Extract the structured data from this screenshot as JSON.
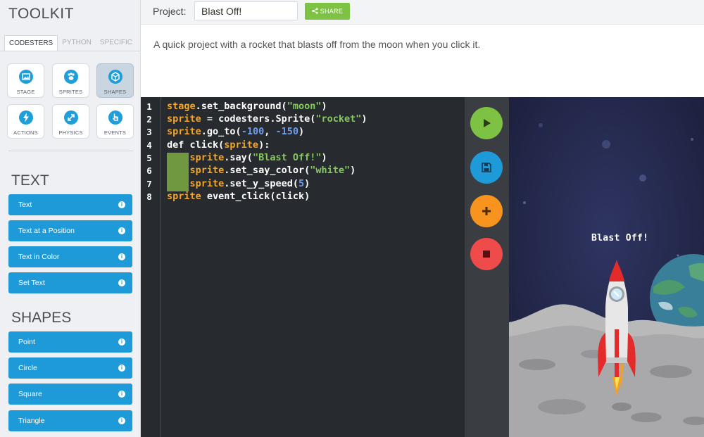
{
  "sidebar": {
    "title": "TOOLKIT",
    "tabs": [
      "CODESTERS",
      "PYTHON",
      "SPECIFIC"
    ],
    "tools": [
      {
        "label": "STAGE",
        "icon": "image-icon"
      },
      {
        "label": "SPRITES",
        "icon": "paw-icon"
      },
      {
        "label": "SHAPES",
        "icon": "cube-icon"
      },
      {
        "label": "ACTIONS",
        "icon": "lightning-icon"
      },
      {
        "label": "PHYSICS",
        "icon": "arrows-icon"
      },
      {
        "label": "EVENTS",
        "icon": "pointer-hand-icon"
      }
    ],
    "text_section": {
      "title": "TEXT",
      "items": [
        "Text",
        "Text at a Position",
        "Text in Color",
        "Set Text"
      ]
    },
    "shapes_section": {
      "title": "SHAPES",
      "items": [
        "Point",
        "Circle",
        "Square",
        "Triangle"
      ]
    }
  },
  "header": {
    "project_label": "Project:",
    "project_name": "Blast Off!",
    "share_label": "SHARE"
  },
  "description": "A quick project with a rocket that blasts off from the moon when you click it.",
  "editor": {
    "line_numbers": [
      "1",
      "2",
      "3",
      "4",
      "5",
      "6",
      "7",
      "8"
    ],
    "lines": [
      "stage.set_background(\"moon\")",
      "sprite = codesters.Sprite(\"rocket\")",
      "sprite.go_to(-100, -150)",
      "def click(sprite):",
      "    sprite.say(\"Blast Off!\")",
      "    sprite.set_say_color(\"white\")",
      "    sprite.set_y_speed(5)",
      "sprite event_click(click)"
    ]
  },
  "controls": [
    {
      "icon": "play-icon",
      "color": "#7dc242"
    },
    {
      "icon": "save-icon",
      "color": "#1e9ad8"
    },
    {
      "icon": "plus-icon",
      "color": "#f7931e"
    },
    {
      "icon": "stop-icon",
      "color": "#ef4b4b"
    }
  ],
  "stage": {
    "say_text": "Blast Off!"
  },
  "colors": {
    "accent_blue": "#1e9ad8",
    "share_green": "#7dc242",
    "editor_bg": "#272a2e",
    "keyword": "#f5a623",
    "string": "#86c95e",
    "number": "#6c9ff2"
  }
}
